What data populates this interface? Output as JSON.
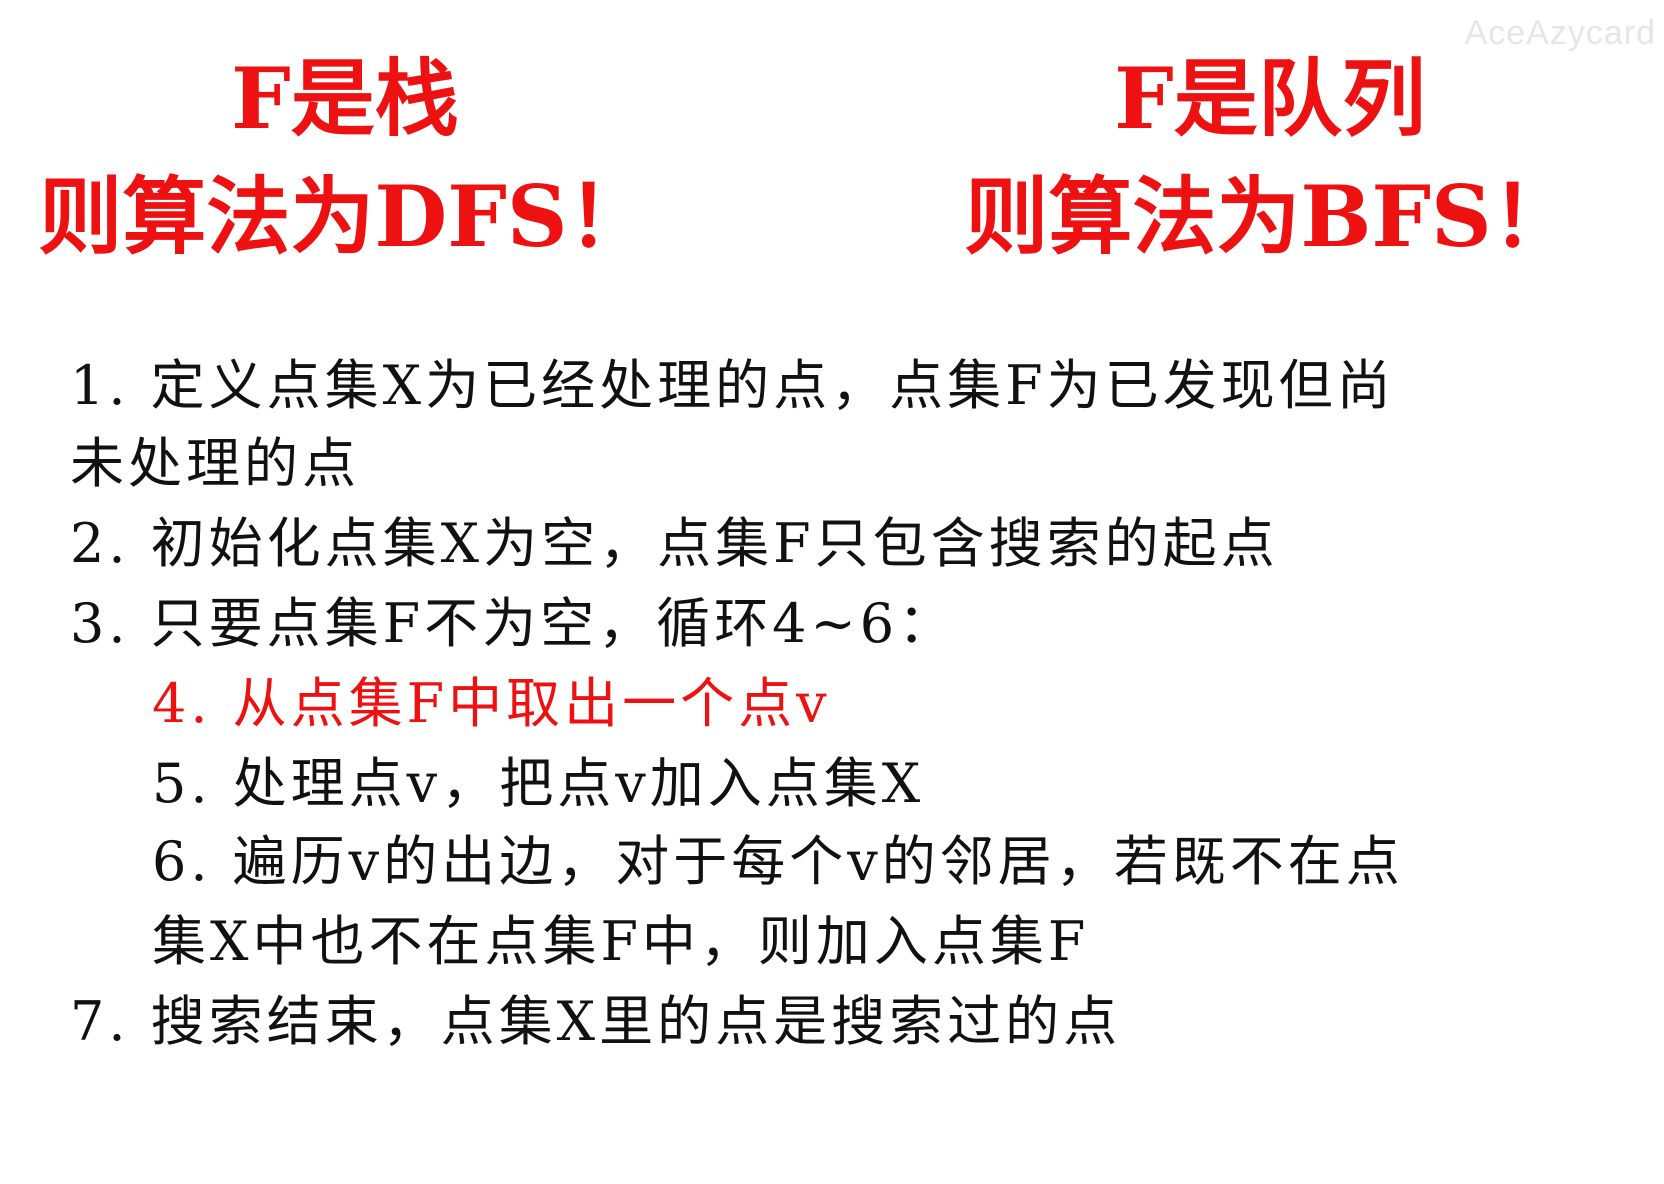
{
  "watermark": "AceAzycard",
  "headings": {
    "left": {
      "line1": "F是栈",
      "line2": "则算法为DFS！"
    },
    "right": {
      "line1": "F是队列",
      "line2": "则算法为BFS！"
    }
  },
  "steps": {
    "step1_line1": "1. 定义点集X为已经处理的点，点集F为已发现但尚",
    "step1_line2": "未处理的点",
    "step2": "2. 初始化点集X为空，点集F只包含搜索的起点",
    "step3": "3. 只要点集F不为空，循环4~6：",
    "step4": "4. 从点集F中取出一个点v",
    "step5": "5. 处理点v，把点v加入点集X",
    "step6_line1": "6. 遍历v的出边，对于每个v的邻居，若既不在点",
    "step6_line2": "集X中也不在点集F中，则加入点集F",
    "step7": "7. 搜索结束，点集X里的点是搜索过的点"
  },
  "colors": {
    "highlight": "#ee1111",
    "text": "#111111",
    "background": "#ffffff"
  }
}
